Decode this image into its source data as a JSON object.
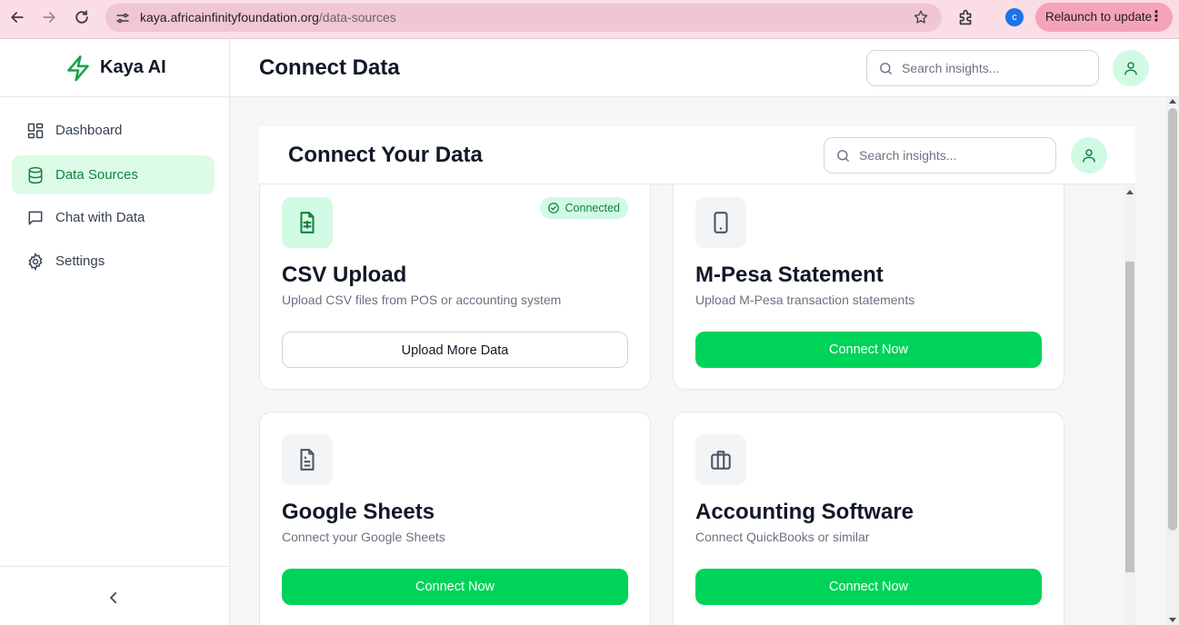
{
  "browser": {
    "url_host": "kaya.africainfinityfoundation.org",
    "url_path": "/data-sources",
    "profile_initial": "c",
    "relaunch_label": "Relaunch to update"
  },
  "sidebar": {
    "brand": "Kaya AI",
    "items": [
      {
        "label": "Dashboard",
        "icon": "grid-icon",
        "active": false
      },
      {
        "label": "Data Sources",
        "icon": "database-icon",
        "active": true
      },
      {
        "label": "Chat with Data",
        "icon": "chat-icon",
        "active": false
      },
      {
        "label": "Settings",
        "icon": "gear-icon",
        "active": false
      }
    ]
  },
  "header": {
    "title": "Connect Data",
    "search_placeholder": "Search insights..."
  },
  "inner": {
    "title": "Connect Your Data",
    "search_placeholder": "Search insights..."
  },
  "cards": [
    {
      "title": "CSV Upload",
      "description": "Upload CSV files from POS or accounting system",
      "button": "Upload More Data",
      "badge": "Connected",
      "icon": "csv-file-icon",
      "connected": true
    },
    {
      "title": "M-Pesa Statement",
      "description": "Upload M-Pesa transaction statements",
      "button": "Connect Now",
      "icon": "phone-icon",
      "connected": false
    },
    {
      "title": "Google Sheets",
      "description": "Connect your Google Sheets",
      "button": "Connect Now",
      "icon": "document-icon",
      "connected": false
    },
    {
      "title": "Accounting Software",
      "description": "Connect QuickBooks or similar",
      "button": "Connect Now",
      "icon": "briefcase-icon",
      "connected": false
    }
  ],
  "colors": {
    "accent": "#00d35a",
    "active_bg": "#dcfce7",
    "brand_green": "#16a34a"
  }
}
